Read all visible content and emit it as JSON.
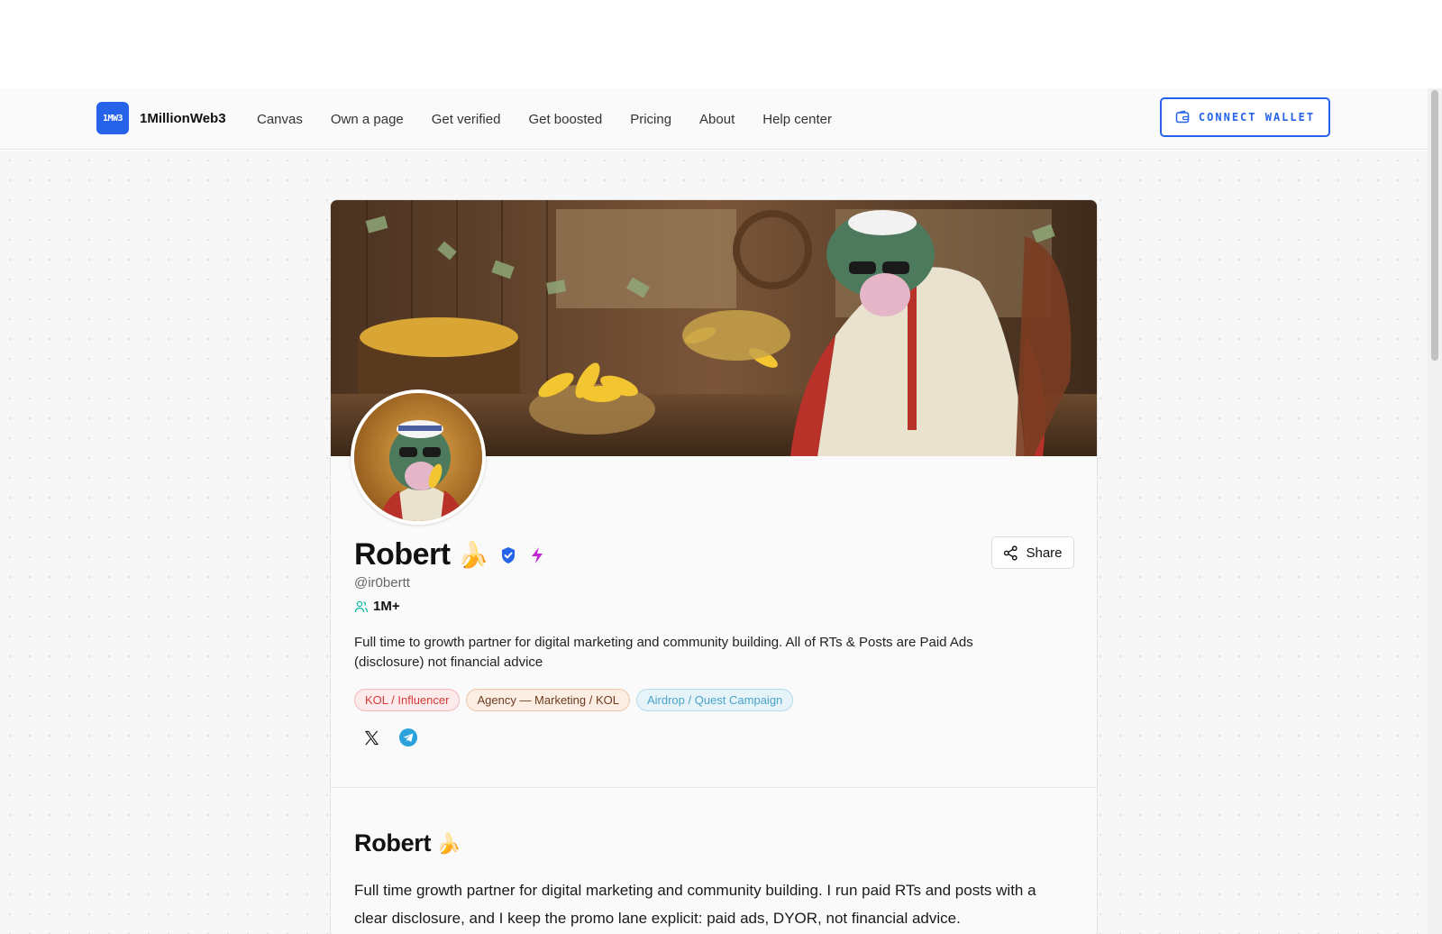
{
  "brand": {
    "logo_text": "1MW3",
    "name": "1MillionWeb3"
  },
  "nav": {
    "links": [
      "Canvas",
      "Own a page",
      "Get verified",
      "Get boosted",
      "Pricing",
      "About",
      "Help center"
    ],
    "connect_wallet": "CONNECT WALLET"
  },
  "profile": {
    "name": "Robert",
    "name_emoji": "🍌",
    "handle": "@ir0bertt",
    "followers": "1M+",
    "bio": "Full time to growth partner for digital marketing and community building. All of RTs & Posts are Paid Ads (disclosure) not financial advice",
    "tags": [
      "KOL / Influencer",
      "Agency — Marketing / KOL",
      "Airdrop / Quest Campaign"
    ],
    "share_label": "Share"
  },
  "section": {
    "title": "Robert",
    "title_emoji": "🍌",
    "body": "Full time growth partner for digital marketing and community building. I run paid RTs and posts with a clear disclosure, and I keep the promo lane explicit: paid ads, DYOR, not financial advice."
  },
  "colors": {
    "accent": "#2563eb",
    "verified": "#2563eb",
    "boost": "#c026d3",
    "tag_red": "#d33b3b",
    "tag_brown": "#6b3b1f",
    "tag_blue": "#4aa3c8",
    "telegram": "#2aa3dc"
  },
  "icons": [
    "wallet-icon",
    "verified-badge-icon",
    "boost-lightning-icon",
    "share-icon",
    "users-icon",
    "x-twitter-icon",
    "telegram-icon"
  ]
}
